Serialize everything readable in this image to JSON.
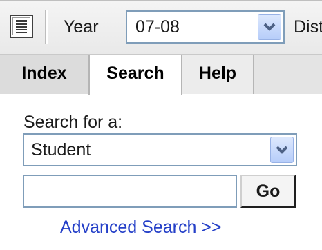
{
  "toolbar": {
    "panel_toggle_icon": "panel-toggle-icon",
    "year_label": "Year",
    "year_value": "07-08",
    "district_label": "District",
    "dropdown_icon": "chevron-down-icon"
  },
  "tabs": [
    {
      "label": "Index",
      "active": false
    },
    {
      "label": "Search",
      "active": true
    },
    {
      "label": "Help",
      "active": false
    }
  ],
  "search": {
    "prompt": "Search for a:",
    "type_value": "Student",
    "query_value": "",
    "go_label": "Go",
    "advanced_link": "Advanced Search >>"
  },
  "colors": {
    "link": "#2540c8",
    "field_border": "#7f9db9",
    "dropdown_button": "#b6cdfa",
    "dropdown_arrow": "#4d6185",
    "active_tab": "#ffffff",
    "inactive_tab": "#dcdcdc"
  }
}
